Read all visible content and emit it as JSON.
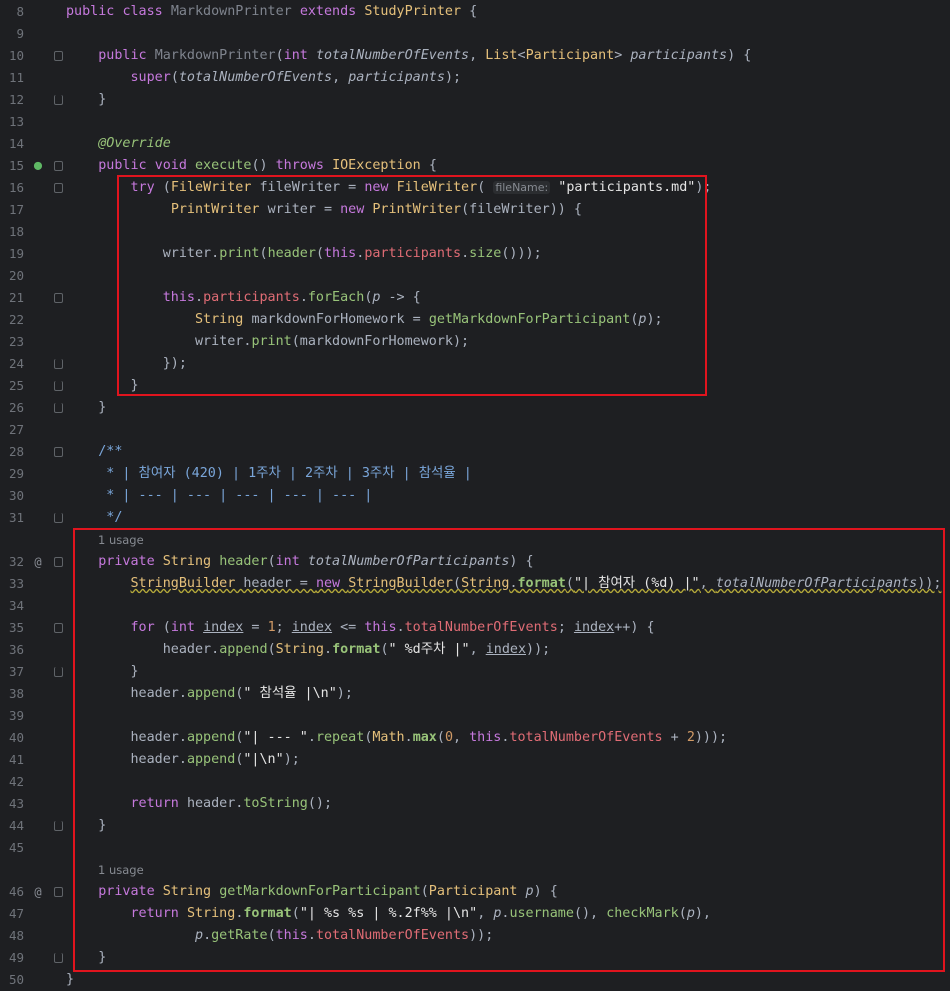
{
  "editor": {
    "lines": [
      {
        "n": "8",
        "code": [
          [
            "c-purp",
            "public "
          ],
          [
            "c-purp",
            "class "
          ],
          [
            "c-gray",
            "MarkdownPrinter "
          ],
          [
            "c-purp",
            "extends "
          ],
          [
            "c-yel",
            "StudyPrinter "
          ],
          [
            "c-txt",
            "{"
          ]
        ]
      },
      {
        "n": "9",
        "code": []
      },
      {
        "n": "10",
        "code": [
          [
            "c-txt",
            "    "
          ],
          [
            "c-purp",
            "public "
          ],
          [
            "c-gray",
            "MarkdownPrinter"
          ],
          [
            "c-txt",
            "("
          ],
          [
            "c-purp",
            "int "
          ],
          [
            "c-italic",
            "totalNumberOfEvents"
          ],
          [
            "c-txt",
            ", "
          ],
          [
            "c-yel",
            "List"
          ],
          [
            "c-txt",
            "<"
          ],
          [
            "c-yel",
            "Participant"
          ],
          [
            "c-txt",
            "> "
          ],
          [
            "c-italic",
            "participants"
          ],
          [
            "c-txt",
            ") {"
          ]
        ]
      },
      {
        "n": "11",
        "code": [
          [
            "c-txt",
            "        "
          ],
          [
            "c-purp",
            "super"
          ],
          [
            "c-txt",
            "("
          ],
          [
            "c-italic",
            "totalNumberOfEvents"
          ],
          [
            "c-txt",
            ", "
          ],
          [
            "c-italic",
            "participants"
          ],
          [
            "c-txt",
            ");"
          ]
        ]
      },
      {
        "n": "12",
        "code": [
          [
            "c-txt",
            "    }"
          ]
        ]
      },
      {
        "n": "13",
        "code": []
      },
      {
        "n": "14",
        "code": [
          [
            "c-txt",
            "    "
          ],
          [
            "c-ann",
            "@Override"
          ]
        ]
      },
      {
        "n": "15",
        "code": [
          [
            "c-txt",
            "    "
          ],
          [
            "c-purp",
            "public "
          ],
          [
            "c-purp",
            "void "
          ],
          [
            "c-grn",
            "execute"
          ],
          [
            "c-txt",
            "() "
          ],
          [
            "c-purp",
            "throws "
          ],
          [
            "c-yel",
            "IOException "
          ],
          [
            "c-txt",
            "{"
          ]
        ]
      },
      {
        "n": "16",
        "code": [
          [
            "c-txt",
            "        "
          ],
          [
            "c-purp",
            "try "
          ],
          [
            "c-txt",
            "("
          ],
          [
            "c-yel",
            "FileWriter "
          ],
          [
            "c-txt",
            "fileWriter = "
          ],
          [
            "c-purp",
            "new "
          ],
          [
            "c-yel",
            "FileWriter"
          ],
          [
            "c-txt",
            "( "
          ],
          [
            "c-hint",
            "fileName:"
          ],
          [
            "c-str",
            " \"participants.md\""
          ],
          [
            "c-txt",
            ");"
          ]
        ]
      },
      {
        "n": "17",
        "code": [
          [
            "c-txt",
            "             "
          ],
          [
            "c-yel",
            "PrintWriter "
          ],
          [
            "c-txt",
            "writer = "
          ],
          [
            "c-purp",
            "new "
          ],
          [
            "c-yel",
            "PrintWriter"
          ],
          [
            "c-txt",
            "(fileWriter)) {"
          ]
        ]
      },
      {
        "n": "18",
        "code": []
      },
      {
        "n": "19",
        "code": [
          [
            "c-txt",
            "            writer."
          ],
          [
            "c-grn",
            "print"
          ],
          [
            "c-txt",
            "("
          ],
          [
            "c-grn",
            "header"
          ],
          [
            "c-txt",
            "("
          ],
          [
            "c-purp",
            "this"
          ],
          [
            "c-txt",
            "."
          ],
          [
            "c-red",
            "participants"
          ],
          [
            "c-txt",
            "."
          ],
          [
            "c-grn",
            "size"
          ],
          [
            "c-txt",
            "()));"
          ]
        ]
      },
      {
        "n": "20",
        "code": []
      },
      {
        "n": "21",
        "code": [
          [
            "c-txt",
            "            "
          ],
          [
            "c-purp",
            "this"
          ],
          [
            "c-txt",
            "."
          ],
          [
            "c-red",
            "participants"
          ],
          [
            "c-txt",
            "."
          ],
          [
            "c-grn",
            "forEach"
          ],
          [
            "c-txt",
            "("
          ],
          [
            "c-italic",
            "p"
          ],
          [
            "c-txt",
            " -> {"
          ]
        ]
      },
      {
        "n": "22",
        "code": [
          [
            "c-txt",
            "                "
          ],
          [
            "c-yel",
            "String "
          ],
          [
            "c-txt",
            "markdownForHomework = "
          ],
          [
            "c-grn",
            "getMarkdownForParticipant"
          ],
          [
            "c-txt",
            "("
          ],
          [
            "c-italic",
            "p"
          ],
          [
            "c-txt",
            ");"
          ]
        ]
      },
      {
        "n": "23",
        "code": [
          [
            "c-txt",
            "                writer."
          ],
          [
            "c-grn",
            "print"
          ],
          [
            "c-txt",
            "(markdownForHomework);"
          ]
        ]
      },
      {
        "n": "24",
        "code": [
          [
            "c-txt",
            "            });"
          ]
        ]
      },
      {
        "n": "25",
        "code": [
          [
            "c-txt",
            "        }"
          ]
        ]
      },
      {
        "n": "26",
        "code": [
          [
            "c-txt",
            "    }"
          ]
        ]
      },
      {
        "n": "27",
        "code": []
      },
      {
        "n": "28",
        "code": [
          [
            "c-com",
            "    /**"
          ]
        ]
      },
      {
        "n": "29",
        "code": [
          [
            "c-com",
            "     * | 참여자 (420) | 1주차 | 2주차 | 3주차 | 참석율 |"
          ]
        ]
      },
      {
        "n": "30",
        "code": [
          [
            "c-com",
            "     * | --- | --- | --- | --- | --- |"
          ]
        ]
      },
      {
        "n": "31",
        "code": [
          [
            "c-com",
            "     */"
          ]
        ]
      },
      {
        "n": "",
        "hint": "1 usage"
      },
      {
        "n": "32",
        "code": [
          [
            "c-txt",
            "    "
          ],
          [
            "c-purp",
            "private "
          ],
          [
            "c-yel",
            "String "
          ],
          [
            "c-grn",
            "header"
          ],
          [
            "c-txt",
            "("
          ],
          [
            "c-purp",
            "int "
          ],
          [
            "c-italic",
            "totalNumberOfParticipants"
          ],
          [
            "c-txt",
            ") {"
          ]
        ]
      },
      {
        "n": "33",
        "code": [
          [
            "c-txt",
            "        "
          ],
          [
            "c-yel-ul",
            "StringBuilder"
          ],
          [
            "c-txt-ul",
            " header = "
          ],
          [
            "c-purp-ul",
            "new "
          ],
          [
            "c-yel-ul",
            "StringBuilder"
          ],
          [
            "c-txt-ul",
            "("
          ],
          [
            "c-yel-ul",
            "String"
          ],
          [
            "c-txt-ul",
            "."
          ],
          [
            "c-grn-b-ul",
            "format"
          ],
          [
            "c-txt-ul",
            "("
          ],
          [
            "c-str-ul",
            "\"| 참여자 (%d) |\""
          ],
          [
            "c-txt-ul",
            ", "
          ],
          [
            "c-italic-ul",
            "totalNumberOfParticipants"
          ],
          [
            "c-txt-ul",
            "));"
          ]
        ]
      },
      {
        "n": "34",
        "code": []
      },
      {
        "n": "35",
        "code": [
          [
            "c-txt",
            "        "
          ],
          [
            "c-purp",
            "for "
          ],
          [
            "c-txt",
            "("
          ],
          [
            "c-purp",
            "int "
          ],
          [
            "c-txt-ul2",
            "index"
          ],
          [
            "c-txt",
            " = "
          ],
          [
            "c-num",
            "1"
          ],
          [
            "c-txt",
            "; "
          ],
          [
            "c-txt-ul2",
            "index"
          ],
          [
            "c-txt",
            " <= "
          ],
          [
            "c-purp",
            "this"
          ],
          [
            "c-txt",
            "."
          ],
          [
            "c-red",
            "totalNumberOfEvents"
          ],
          [
            "c-txt",
            "; "
          ],
          [
            "c-txt-ul2",
            "index"
          ],
          [
            "c-txt",
            "++) {"
          ]
        ]
      },
      {
        "n": "36",
        "code": [
          [
            "c-txt",
            "            header."
          ],
          [
            "c-grn",
            "append"
          ],
          [
            "c-txt",
            "("
          ],
          [
            "c-yel",
            "String"
          ],
          [
            "c-txt",
            "."
          ],
          [
            "c-grn-b",
            "format"
          ],
          [
            "c-txt",
            "("
          ],
          [
            "c-str",
            "\" %d주차 |\""
          ],
          [
            "c-txt",
            ", "
          ],
          [
            "c-txt-ul2",
            "index"
          ],
          [
            "c-txt",
            "));"
          ]
        ]
      },
      {
        "n": "37",
        "code": [
          [
            "c-txt",
            "        }"
          ]
        ]
      },
      {
        "n": "38",
        "code": [
          [
            "c-txt",
            "        header."
          ],
          [
            "c-grn",
            "append"
          ],
          [
            "c-txt",
            "("
          ],
          [
            "c-str",
            "\" 참석율 |\\n\""
          ],
          [
            "c-txt",
            ");"
          ]
        ]
      },
      {
        "n": "39",
        "code": []
      },
      {
        "n": "40",
        "code": [
          [
            "c-txt",
            "        header."
          ],
          [
            "c-grn",
            "append"
          ],
          [
            "c-txt",
            "("
          ],
          [
            "c-str",
            "\"| --- \""
          ],
          [
            "c-txt",
            "."
          ],
          [
            "c-grn",
            "repeat"
          ],
          [
            "c-txt",
            "("
          ],
          [
            "c-yel",
            "Math"
          ],
          [
            "c-txt",
            "."
          ],
          [
            "c-grn-b",
            "max"
          ],
          [
            "c-txt",
            "("
          ],
          [
            "c-num",
            "0"
          ],
          [
            "c-txt",
            ", "
          ],
          [
            "c-purp",
            "this"
          ],
          [
            "c-txt",
            "."
          ],
          [
            "c-red",
            "totalNumberOfEvents"
          ],
          [
            "c-txt",
            " + "
          ],
          [
            "c-num",
            "2"
          ],
          [
            "c-txt",
            ")));"
          ]
        ]
      },
      {
        "n": "41",
        "code": [
          [
            "c-txt",
            "        header."
          ],
          [
            "c-grn",
            "append"
          ],
          [
            "c-txt",
            "("
          ],
          [
            "c-str",
            "\"|\\n\""
          ],
          [
            "c-txt",
            ");"
          ]
        ]
      },
      {
        "n": "42",
        "code": []
      },
      {
        "n": "43",
        "code": [
          [
            "c-txt",
            "        "
          ],
          [
            "c-purp",
            "return "
          ],
          [
            "c-txt",
            "header."
          ],
          [
            "c-grn",
            "toString"
          ],
          [
            "c-txt",
            "();"
          ]
        ]
      },
      {
        "n": "44",
        "code": [
          [
            "c-txt",
            "    }"
          ]
        ]
      },
      {
        "n": "45",
        "code": []
      },
      {
        "n": "",
        "hint": "1 usage"
      },
      {
        "n": "46",
        "code": [
          [
            "c-txt",
            "    "
          ],
          [
            "c-purp",
            "private "
          ],
          [
            "c-yel",
            "String "
          ],
          [
            "c-grn",
            "getMarkdownForParticipant"
          ],
          [
            "c-txt",
            "("
          ],
          [
            "c-yel",
            "Participant "
          ],
          [
            "c-italic",
            "p"
          ],
          [
            "c-txt",
            ") {"
          ]
        ]
      },
      {
        "n": "47",
        "code": [
          [
            "c-txt",
            "        "
          ],
          [
            "c-purp",
            "return "
          ],
          [
            "c-yel",
            "String"
          ],
          [
            "c-txt",
            "."
          ],
          [
            "c-grn-b",
            "format"
          ],
          [
            "c-txt",
            "("
          ],
          [
            "c-str",
            "\"| %s %s | %.2f%% |\\n\""
          ],
          [
            "c-txt",
            ", "
          ],
          [
            "c-italic",
            "p"
          ],
          [
            "c-txt",
            "."
          ],
          [
            "c-grn",
            "username"
          ],
          [
            "c-txt",
            "(), "
          ],
          [
            "c-grn",
            "checkMark"
          ],
          [
            "c-txt",
            "("
          ],
          [
            "c-italic",
            "p"
          ],
          [
            "c-txt",
            "),"
          ]
        ]
      },
      {
        "n": "48",
        "code": [
          [
            "c-txt",
            "                "
          ],
          [
            "c-italic",
            "p"
          ],
          [
            "c-txt",
            "."
          ],
          [
            "c-grn",
            "getRate"
          ],
          [
            "c-txt",
            "("
          ],
          [
            "c-purp",
            "this"
          ],
          [
            "c-txt",
            "."
          ],
          [
            "c-red",
            "totalNumberOfEvents"
          ],
          [
            "c-txt",
            "));"
          ]
        ]
      },
      {
        "n": "49",
        "code": [
          [
            "c-txt",
            "    }"
          ]
        ]
      },
      {
        "n": "50",
        "code": [
          [
            "c-txt",
            "}"
          ]
        ]
      }
    ],
    "gutter_icons": {
      "15": "override-icon",
      "32": "at-icon",
      "46": "at-icon"
    },
    "highlight_color": "#e0141e"
  }
}
